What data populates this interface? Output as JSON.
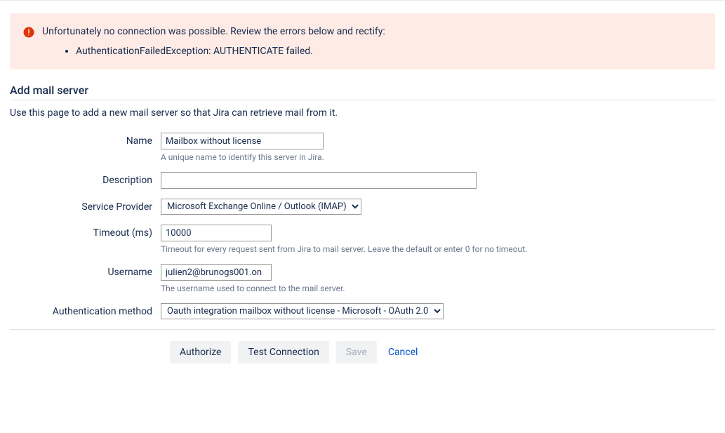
{
  "error": {
    "title": "Unfortunately no connection was possible. Review the errors below and rectify:",
    "items": [
      "AuthenticationFailedException: AUTHENTICATE failed."
    ]
  },
  "section": {
    "title": "Add mail server",
    "description": "Use this page to add a new mail server so that Jira can retrieve mail from it."
  },
  "form": {
    "name": {
      "label": "Name",
      "value": "Mailbox without license",
      "help": "A unique name to identify this server in Jira."
    },
    "description": {
      "label": "Description",
      "value": ""
    },
    "service_provider": {
      "label": "Service Provider",
      "value": "Microsoft Exchange Online / Outlook (IMAP)"
    },
    "timeout": {
      "label": "Timeout (ms)",
      "value": "10000",
      "help": "Timeout for every request sent from Jira to mail server. Leave the default or enter 0 for no timeout."
    },
    "username": {
      "label": "Username",
      "value": "julien2@brunogs001.on",
      "help": "The username used to connect to the mail server."
    },
    "auth_method": {
      "label": "Authentication method",
      "value": "Oauth integration mailbox without license - Microsoft - OAuth 2.0"
    }
  },
  "buttons": {
    "authorize": "Authorize",
    "test_connection": "Test Connection",
    "save": "Save",
    "cancel": "Cancel"
  }
}
